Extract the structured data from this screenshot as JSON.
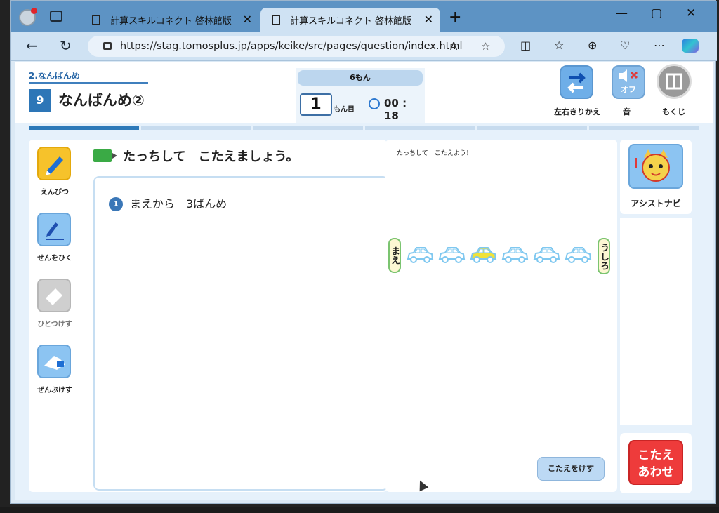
{
  "browser": {
    "tabs": [
      {
        "label": "計算スキルコネクト 啓林館版",
        "active": false
      },
      {
        "label": "計算スキルコネクト 啓林館版",
        "active": true
      }
    ],
    "new_tab": "+",
    "url": "https://stag.tomosplus.jp/apps/keike/src/pages/question/index.html",
    "window_controls": {
      "minimize": "—",
      "maximize": "▢",
      "close": "✕"
    }
  },
  "header": {
    "unit_name": "2.なんばんめ",
    "lesson_number": "9",
    "lesson_title": "なんばんめ②",
    "total_questions": "6もん",
    "current_question": "1",
    "current_label": "もん目",
    "timer": "00 : 18",
    "swap_label": "左右きりかえ",
    "sound_state": "オフ",
    "sound_label": "音",
    "menu_label": "もくじ",
    "progress_steps": 6,
    "progress_current": 1
  },
  "tools": {
    "pencil": "えんぴつ",
    "line": "せんをひく",
    "erase_one": "ひとつけす",
    "erase_all": "ぜんぶけす"
  },
  "question": {
    "instruction": "たっちして　こたえましょう。",
    "item_number": "1",
    "item_text": "まえから　3ばんめ"
  },
  "answer_area": {
    "hint": "たっちして　こたえよう！",
    "front_label": "まえ",
    "back_label": "うしろ",
    "cars": [
      "blue",
      "blue",
      "yellow",
      "blue",
      "blue",
      "blue"
    ],
    "clear_button": "こたえをけす"
  },
  "assist": {
    "label": "アシストナビ"
  },
  "submit": {
    "line1": "こたえ",
    "line2": "あわせ"
  },
  "colors": {
    "accent": "#2d76b7",
    "submit": "#ee3b3b",
    "pencil": "#f6c22b",
    "car_selected": "#f0e23a",
    "car_default": "#7fc8f0"
  }
}
